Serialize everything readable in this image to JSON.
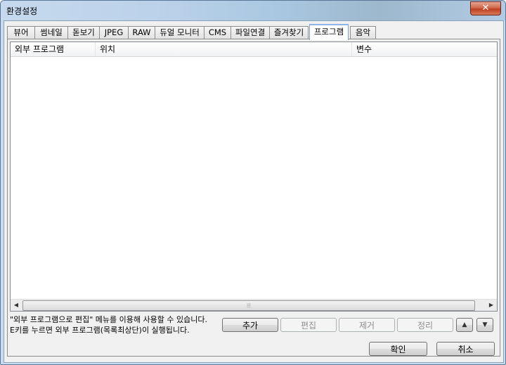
{
  "window": {
    "title": "환경설정",
    "close_glyph": "✕"
  },
  "tabs": [
    "뷰어",
    "썸네일",
    "돋보기",
    "JPEG",
    "RAW",
    "듀얼 모니터",
    "CMS",
    "파일연결",
    "즐겨찾기",
    "프로그램",
    "음악"
  ],
  "active_tab": "프로그램",
  "list": {
    "columns": [
      "외부 프로그램",
      "위치",
      "변수"
    ],
    "rows": []
  },
  "scrollbar": {
    "left_glyph": "◀",
    "right_glyph": "▶",
    "grip": "⦙⦙⦙"
  },
  "help": {
    "line1": "\"외부 프로그램으로 편집\" 메뉴를 이용해 사용할 수 있습니다.",
    "line2": "E키를 누르면 외부 프로그램(목록최상단)이 실행됩니다."
  },
  "actions": {
    "add": "추가",
    "edit": "편집",
    "remove": "제거",
    "sort": "정리",
    "up_glyph": "▲",
    "down_glyph": "▼"
  },
  "footer": {
    "ok": "확인",
    "cancel": "취소"
  }
}
